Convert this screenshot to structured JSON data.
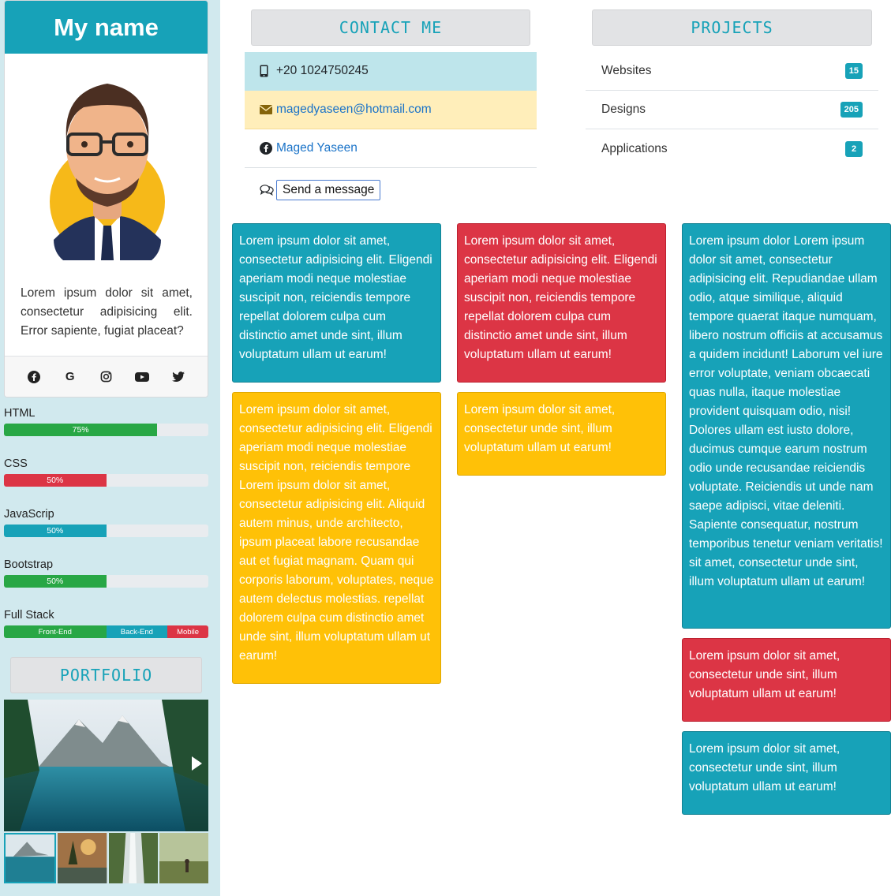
{
  "profile": {
    "name": "My name",
    "bio": "Lorem ipsum dolor sit amet, consectetur adipisicing elit. Error sapiente, fugiat placeat?",
    "social": [
      "facebook-icon",
      "google-icon",
      "instagram-icon",
      "youtube-icon",
      "twitter-icon"
    ]
  },
  "skills": {
    "html": {
      "label": "HTML",
      "percent_text": "75%",
      "value": 75
    },
    "css": {
      "label": "CSS",
      "percent_text": "50%",
      "value": 50
    },
    "javascript": {
      "label": "JavaScrip",
      "percent_text": "50%",
      "value": 50
    },
    "bootstrap": {
      "label": "Bootstrap",
      "percent_text": "50%",
      "value": 50
    },
    "fullstack": {
      "label": "Full Stack",
      "segments": [
        {
          "label": "Front-End",
          "value": 50,
          "color": "#28a745"
        },
        {
          "label": "Back-End",
          "value": 30,
          "color": "#17a2b8"
        },
        {
          "label": "Mobile",
          "value": 20,
          "color": "#dc3545"
        }
      ]
    }
  },
  "portfolio": {
    "title": "PORTFOLIO",
    "active_slide": 1,
    "slide_count": 4
  },
  "contact": {
    "title": "CONTACT ME",
    "phone": "+20 1024750245",
    "email": "magedyaseen@hotmail.com",
    "facebook": "Maged Yaseen",
    "message_button": "Send a message"
  },
  "projects": {
    "title": "PROJECTS",
    "items": [
      {
        "label": "Websites",
        "count": "15"
      },
      {
        "label": "Designs",
        "count": "205"
      },
      {
        "label": "Applications",
        "count": "2"
      }
    ]
  },
  "cards": {
    "c1": "Lorem ipsum dolor sit amet, consectetur adipisicing elit. Eligendi aperiam modi neque molestiae suscipit non, reiciendis tempore repellat dolorem culpa cum distinctio amet unde sint, illum voluptatum ullam ut earum!",
    "c2": "Lorem ipsum dolor sit amet, consectetur adipisicing elit. Eligendi aperiam modi neque molestiae suscipit non, reiciendis tempore repellat dolorem culpa cum distinctio amet unde sint, illum voluptatum ullam ut earum!",
    "c3": "Lorem ipsum dolor Lorem ipsum dolor sit amet, consectetur adipisicing elit. Repudiandae ullam odio, atque similique, aliquid tempore quaerat itaque numquam, libero nostrum officiis at accusamus a quidem incidunt! Laborum vel iure error voluptate, veniam obcaecati quas nulla, itaque molestiae provident quisquam odio, nisi! Dolores ullam est iusto dolore, ducimus cumque earum nostrum odio unde recusandae reiciendis voluptate. Reiciendis ut unde nam saepe adipisci, vitae deleniti. Sapiente consequatur, nostrum temporibus tenetur veniam veritatis! sit amet, consectetur unde sint, illum voluptatum ullam ut earum!",
    "c4": "Lorem ipsum dolor sit amet, consectetur adipisicing elit. Eligendi aperiam modi neque molestiae suscipit non, reiciendis tempore Lorem ipsum dolor sit amet, consectetur adipisicing elit. Aliquid autem minus, unde architecto, ipsum placeat labore recusandae aut et fugiat magnam. Quam qui corporis laborum, voluptates, neque autem delectus molestias. repellat dolorem culpa cum distinctio amet unde sint, illum voluptatum ullam ut earum!",
    "c5": "Lorem ipsum dolor sit amet, consectetur unde sint, illum voluptatum ullam ut earum!",
    "c6": "Lorem ipsum dolor sit amet, consectetur unde sint, illum voluptatum ullam ut earum!",
    "c7": "Lorem ipsum dolor sit amet, consectetur unde sint, illum voluptatum ullam ut earum!"
  },
  "colors": {
    "primary": "#17a2b8",
    "danger": "#dc3545",
    "warning": "#ffc107",
    "success": "#28a745",
    "sidebar_bg": "#d1e9ee"
  }
}
